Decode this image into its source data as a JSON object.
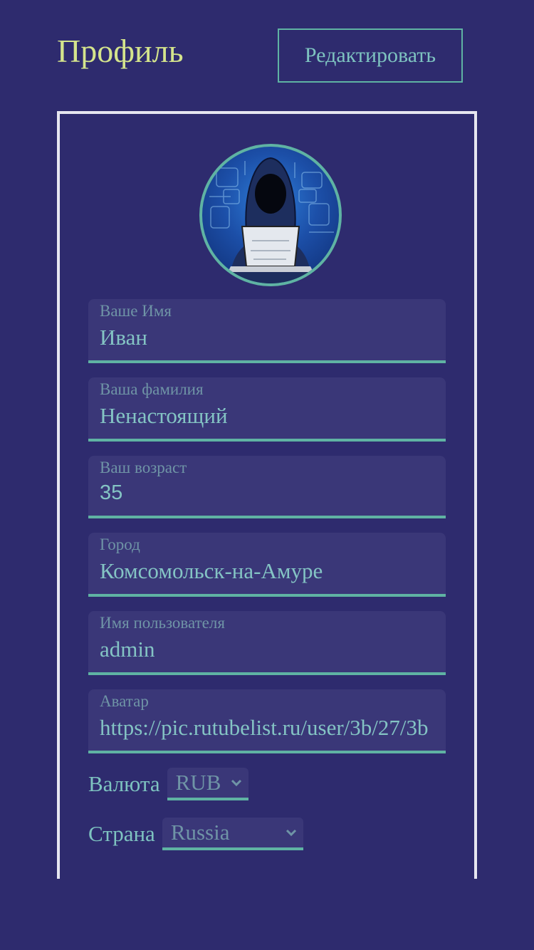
{
  "header": {
    "title": "Профиль",
    "edit_label": "Редактировать"
  },
  "profile": {
    "avatar_icon": "hooded-hacker-avatar",
    "fields": [
      {
        "label": "Ваше Имя",
        "value": "Иван"
      },
      {
        "label": "Ваша фамилия",
        "value": "Ненастоящий"
      },
      {
        "label": "Ваш возраст",
        "value": "35"
      },
      {
        "label": "Город",
        "value": "Комсомольск-на-Амуре"
      },
      {
        "label": "Имя пользователя",
        "value": "admin"
      },
      {
        "label": "Аватар",
        "value": "https://pic.rutubelist.ru/user/3b/27/3b"
      }
    ],
    "currency": {
      "label": "Валюта",
      "value": "RUB"
    },
    "country": {
      "label": "Страна",
      "value": "Russia"
    }
  },
  "colors": {
    "background": "#2e2b6e",
    "title": "#d4e48c",
    "accent": "#5fb3a3",
    "field_bg": "#3a3778"
  }
}
